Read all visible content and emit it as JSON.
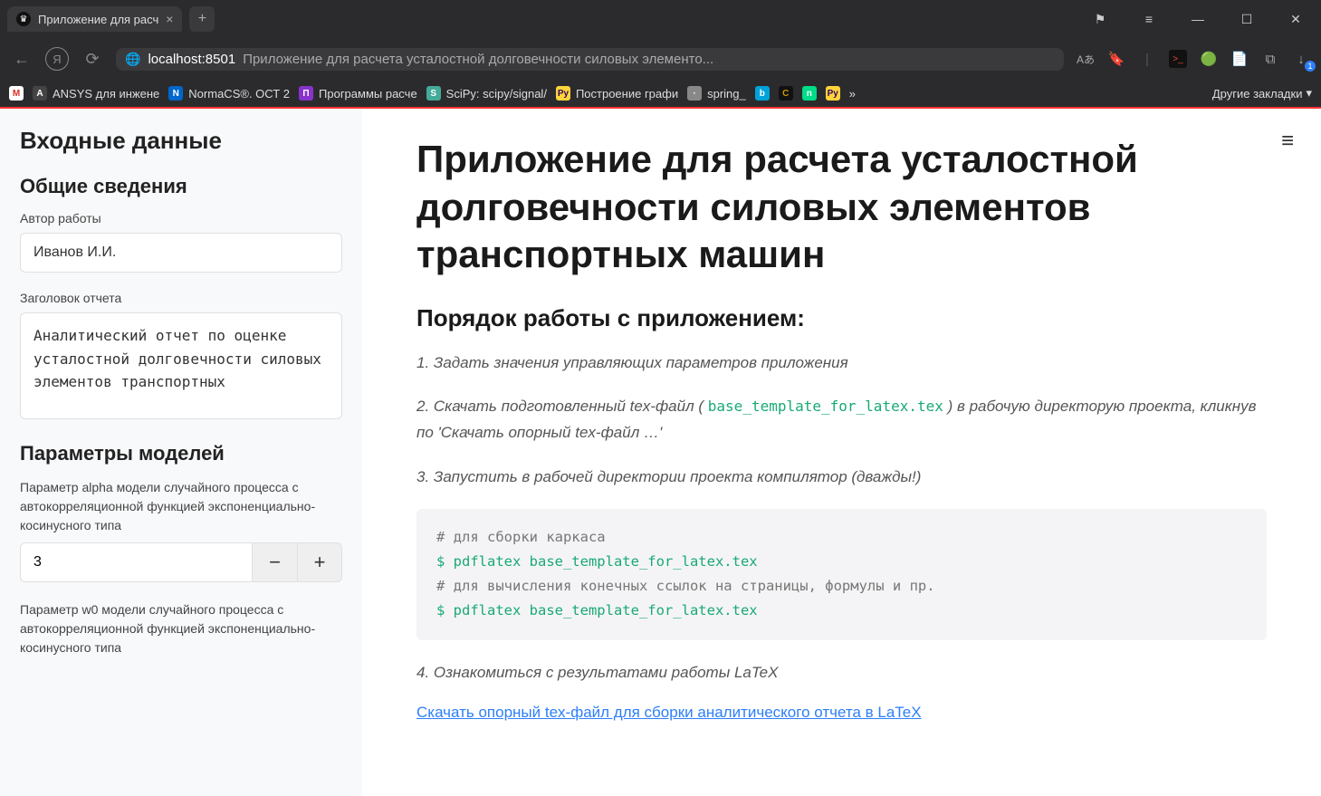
{
  "browser": {
    "tab_title": "Приложение для расч",
    "url_host": "localhost:8501",
    "url_title": "Приложение для расчета усталостной долговечности силовых элементо...",
    "bookmarks": [
      {
        "label": "",
        "icon": "M",
        "color": "#d93025"
      },
      {
        "label": "ANSYS для инжене",
        "icon": "A",
        "color": "#555"
      },
      {
        "label": "NormaCS®. ОСТ 2",
        "icon": "N",
        "color": "#2d88ff"
      },
      {
        "label": "Программы расче",
        "icon": "П",
        "color": "#8833cc"
      },
      {
        "label": "SciPy: scipy/signal/",
        "icon": "S",
        "color": "#4a9"
      },
      {
        "label": "Построение графи",
        "icon": "Py",
        "color": "#ffd43b"
      },
      {
        "label": "spring_",
        "icon": "",
        "color": "#888"
      },
      {
        "label": "",
        "icon": "b",
        "color": "#00a3d9"
      },
      {
        "label": "",
        "icon": "C",
        "color": "#111"
      },
      {
        "label": "",
        "icon": "N",
        "color": "#0d8"
      },
      {
        "label": "",
        "icon": "Py",
        "color": "#ffd43b"
      }
    ],
    "bookmarks_more": "Другие закладки",
    "addr_icons": {
      "translate": "Aあ",
      "bookmark_fill": "🔖",
      "terminal": ">_",
      "evernote": "🐘",
      "note": "📄",
      "ext": "⧉",
      "dl": "↓"
    }
  },
  "sidebar": {
    "title": "Входные данные",
    "section1": "Общие сведения",
    "author_label": "Автор работы",
    "author_value": "Иванов И.И.",
    "report_title_label": "Заголовок отчета",
    "report_title_value": "Аналитический отчет по оценке усталостной долговечности силовых элементов транспортных",
    "section2": "Параметры моделей",
    "alpha_label": "Параметр alpha модели случайного процесса с автокорреляционной функцией экспоненциально-косинусного типа",
    "alpha_value": "3",
    "w0_label": "Параметр w0 модели случайного процесса с автокорреляционной функцией экспоненциально-косинусного типа"
  },
  "main": {
    "title": "Приложение для расчета усталостной долговечности силовых элементов транспортных машин",
    "subtitle": "Порядок работы с приложением:",
    "step1": "1. Задать значения управляющих параметров приложения",
    "step2_a": "2. Скачать подготовленный tex-файл ( ",
    "step2_code": "base_template_for_latex.tex",
    "step2_b": " ) в рабочую директорую проекта, кликнув по 'Скачать опорный tex-файл …'",
    "step3": "3. Запустить в рабочей директории проекта компилятор (дважды!)",
    "code_comment1": "# для сборки каркаса",
    "code_line1": "$ pdflatex base_template_for_latex.tex",
    "code_comment2": "# для вычисления конечных ссылок на страницы, формулы и пр.",
    "code_line2": "$ pdflatex base_template_for_latex.tex",
    "step4": "4. Ознакомиться с результатами работы LaTeX",
    "download_link": "Скачать опорный tex-файл для сборки аналитического отчета в LaTeX"
  }
}
